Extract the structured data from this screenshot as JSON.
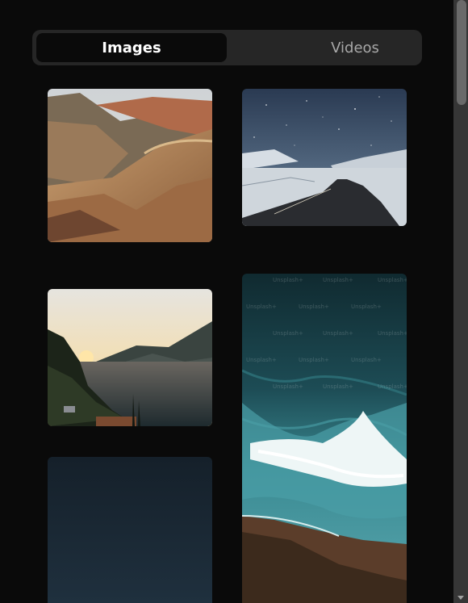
{
  "tabs": [
    {
      "label": "Images",
      "active": true
    },
    {
      "label": "Videos",
      "active": false
    }
  ],
  "gallery": {
    "images": [
      {
        "subject": "desert mountains"
      },
      {
        "subject": "snowy road under stars"
      },
      {
        "subject": "lake at sunset"
      },
      {
        "subject": "ocean waves from cliff",
        "watermark": "Unsplash+"
      },
      {
        "subject": "dark blue gradient"
      }
    ]
  },
  "colors": {
    "background": "#0a0a0a",
    "tab_bar": "#262626",
    "active_tab": "#0a0a0a"
  }
}
